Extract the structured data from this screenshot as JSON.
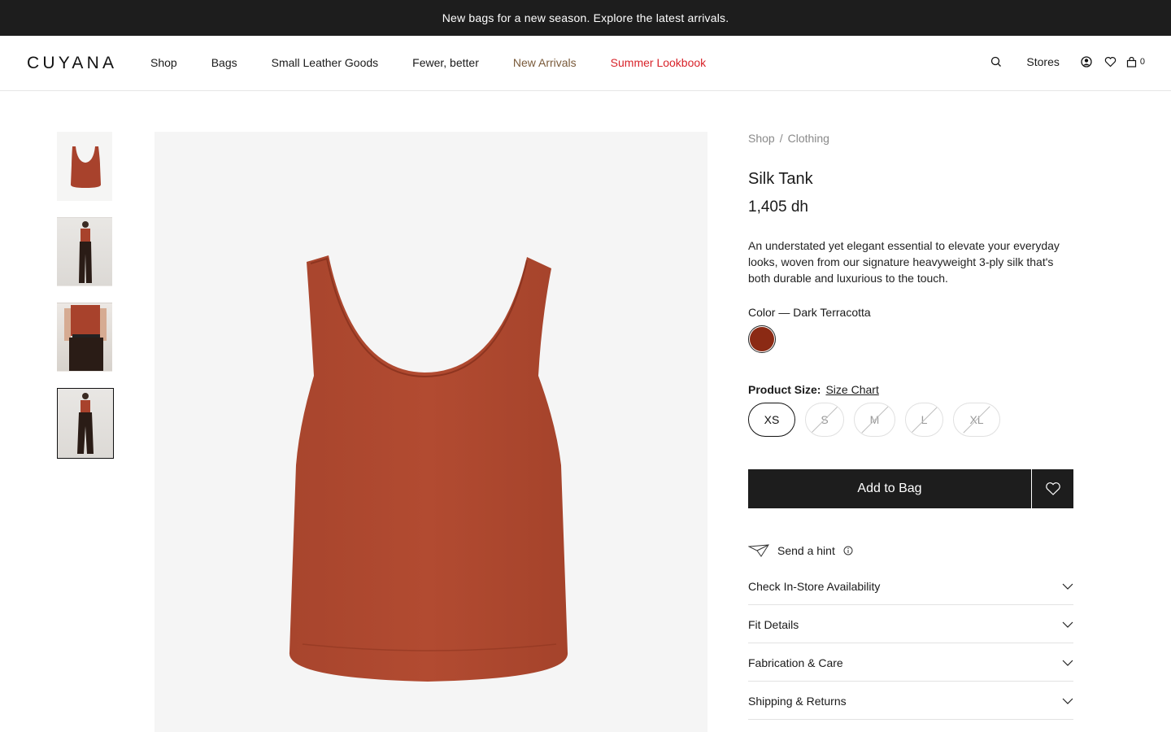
{
  "announcement": "New bags for a new season. Explore the latest arrivals.",
  "header": {
    "logo": "CUYANA",
    "nav": [
      "Shop",
      "Bags",
      "Small Leather Goods",
      "Fewer, better",
      "New Arrivals",
      "Summer Lookbook"
    ],
    "stores_label": "Stores",
    "cart_count": "0",
    "icons": [
      "search-icon",
      "account-icon",
      "heart-icon",
      "bag-icon"
    ]
  },
  "colors": {
    "accent_summer": "#d8232a",
    "accent_new": "#7a5a3a",
    "swatch": "#8b2a14",
    "button": "#1d1d1d"
  },
  "breadcrumb": {
    "items": [
      "Shop",
      "Clothing"
    ],
    "separator": "/"
  },
  "product": {
    "title": "Silk Tank",
    "price": "1,405 dh",
    "description": "An understated yet elegant essential to elevate your everyday looks, woven from our signature heavyweight 3-ply silk that's both durable and luxurious to the touch.",
    "color_label": "Color — Dark Terracotta",
    "size_label": "Product Size:",
    "size_chart_link": "Size Chart",
    "sizes": [
      "XS",
      "S",
      "M",
      "L",
      "XL"
    ],
    "selected_size": "XS",
    "add_to_bag": "Add to Bag",
    "send_hint": "Send a hint"
  },
  "accordion": [
    "Check In-Store Availability",
    "Fit Details",
    "Fabrication & Care",
    "Shipping & Returns"
  ]
}
